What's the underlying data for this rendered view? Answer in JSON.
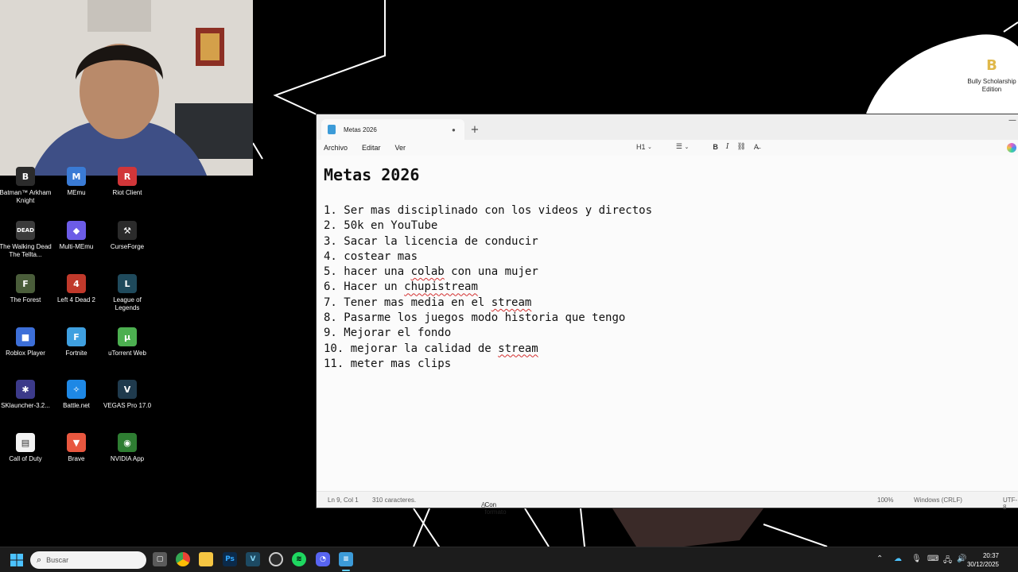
{
  "desktop": {
    "icons": [
      {
        "label": "Batman™ Arkham Knight",
        "color": "#2b2b2b",
        "glyph": "B"
      },
      {
        "label": "MEmu",
        "color": "#3a7bd5",
        "glyph": "M"
      },
      {
        "label": "Riot Client",
        "color": "#d13639",
        "glyph": "R"
      },
      {
        "label": "The Walking Dead The Tellta...",
        "color": "#3b3b3b",
        "glyph": "DEAD"
      },
      {
        "label": "Multi-MEmu",
        "color": "#6c5ce7",
        "glyph": "◆"
      },
      {
        "label": "CurseForge",
        "color": "#2b2b2b",
        "glyph": "⚒"
      },
      {
        "label": "The Forest",
        "color": "#4a5d3a",
        "glyph": "F"
      },
      {
        "label": "Left 4 Dead 2",
        "color": "#c0392b",
        "glyph": "4"
      },
      {
        "label": "League of Legends",
        "color": "#1f4a5c",
        "glyph": "L"
      },
      {
        "label": "Roblox Player",
        "color": "#3d6fd8",
        "glyph": "■"
      },
      {
        "label": "Fortnite",
        "color": "#3fa0e0",
        "glyph": "F"
      },
      {
        "label": "uTorrent Web",
        "color": "#4caf50",
        "glyph": "µ"
      },
      {
        "label": "SKlauncher-3.2...",
        "color": "#3c3a8a",
        "glyph": "✱"
      },
      {
        "label": "Battle.net",
        "color": "#1e88e5",
        "glyph": "✧"
      },
      {
        "label": "VEGAS Pro 17.0",
        "color": "#1f3a4d",
        "glyph": "V"
      },
      {
        "label": "Call of Duty",
        "color": "#f3f3f3",
        "glyph": "▤"
      },
      {
        "label": "Brave",
        "color": "#e8573f",
        "glyph": "▼"
      },
      {
        "label": "NVIDIA App",
        "color": "#2e7d32",
        "glyph": "◉"
      }
    ],
    "bully_icon_label": "Bully Scholarship Edition",
    "bully_glyph": "B"
  },
  "notepad": {
    "tab_title": "Metas 2026",
    "new_tab": "+",
    "tab_close": "●",
    "menu": {
      "file": "Archivo",
      "edit": "Editar",
      "view": "Ver"
    },
    "format": {
      "heading": "H1",
      "list": "☰",
      "bold": "B",
      "italic": "I",
      "link": "⛓",
      "clear": "A̶"
    },
    "doc_title": "Metas 2026",
    "lines": [
      {
        "num": "1. ",
        "pre": "Ser mas disciplinado con los videos y directos",
        "sp": "",
        "post": ""
      },
      {
        "num": "2. ",
        "pre": "50k en YouTube",
        "sp": "",
        "post": ""
      },
      {
        "num": "3. ",
        "pre": "Sacar la licencia de conducir",
        "sp": "",
        "post": ""
      },
      {
        "num": "4. ",
        "pre": "costear mas",
        "sp": "",
        "post": ""
      },
      {
        "num": "5. ",
        "pre": "hacer una ",
        "sp": "colab",
        "post": " con una mujer"
      },
      {
        "num": "6. ",
        "pre": "Hacer un ",
        "sp": "chupistream",
        "post": ""
      },
      {
        "num": "7. ",
        "pre": "Tener mas media en el ",
        "sp": "stream",
        "post": ""
      },
      {
        "num": "8. ",
        "pre": "Pasarme los juegos modo historia que tengo",
        "sp": "",
        "post": ""
      },
      {
        "num": "9. ",
        "pre": "Mejorar el fondo",
        "sp": "",
        "post": ""
      },
      {
        "num": "10. ",
        "pre": "mejorar la calidad de ",
        "sp": "stream",
        "post": ""
      },
      {
        "num": "11. ",
        "pre": "meter mas clips",
        "sp": "",
        "post": ""
      }
    ],
    "status": {
      "position": "Ln 9, Col 1",
      "chars": "310 caracteres.",
      "format": "Con formato",
      "zoom": "100%",
      "eol": "Windows (CRLF)",
      "encoding": "UTF-8"
    }
  },
  "taskbar": {
    "search_placeholder": "Buscar",
    "apps": [
      "file-explorer-cards",
      "chrome",
      "file-explorer",
      "photoshop",
      "vegas",
      "obs",
      "spotify",
      "discord",
      "notepad"
    ],
    "clock_time": "20:37",
    "clock_date": "30/12/2025"
  }
}
